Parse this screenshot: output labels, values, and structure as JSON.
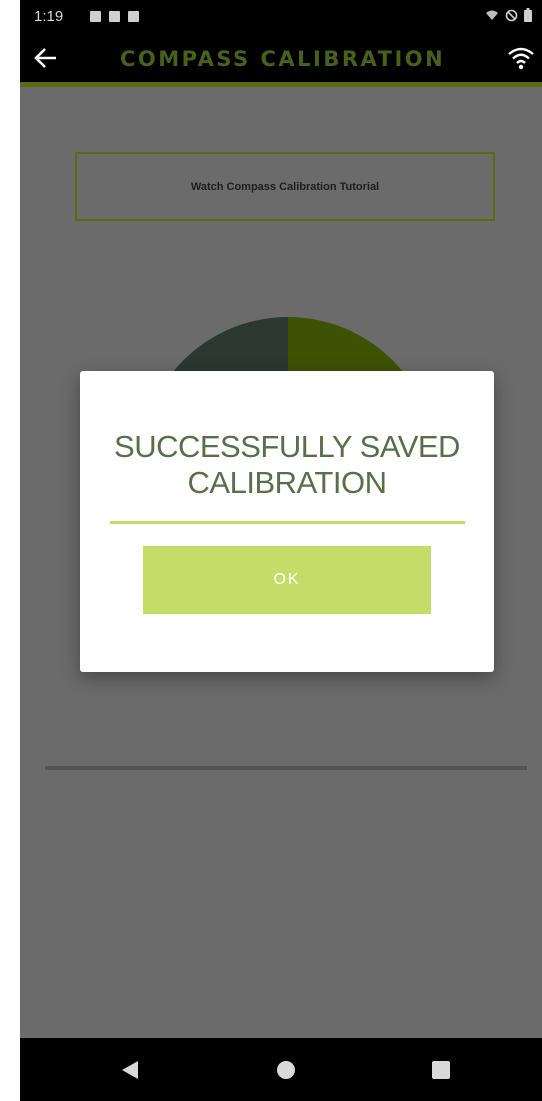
{
  "status_bar": {
    "time": "1:19",
    "icons_left": [
      "image-icon",
      "notification-icon",
      "notification-icon"
    ],
    "icons_right": [
      "wifi-icon",
      "do-not-disturb-icon",
      "battery-icon"
    ]
  },
  "app_bar": {
    "title": "COMPASS CALIBRATION",
    "back_icon": "arrow-left-icon",
    "wifi_icon": "wifi-icon",
    "title_color": "#49601a",
    "accent_color": "#5a6b12"
  },
  "main": {
    "tutorial_button_label": "Watch Compass Calibration Tutorial"
  },
  "dialog": {
    "title": "SUCCESSFULLY SAVED CALIBRATION",
    "ok_label": "OK",
    "button_color": "#c5dd68"
  },
  "nav_bar": {
    "back_icon": "triangle-back-icon",
    "home_icon": "circle-home-icon",
    "recents_icon": "square-recents-icon"
  }
}
